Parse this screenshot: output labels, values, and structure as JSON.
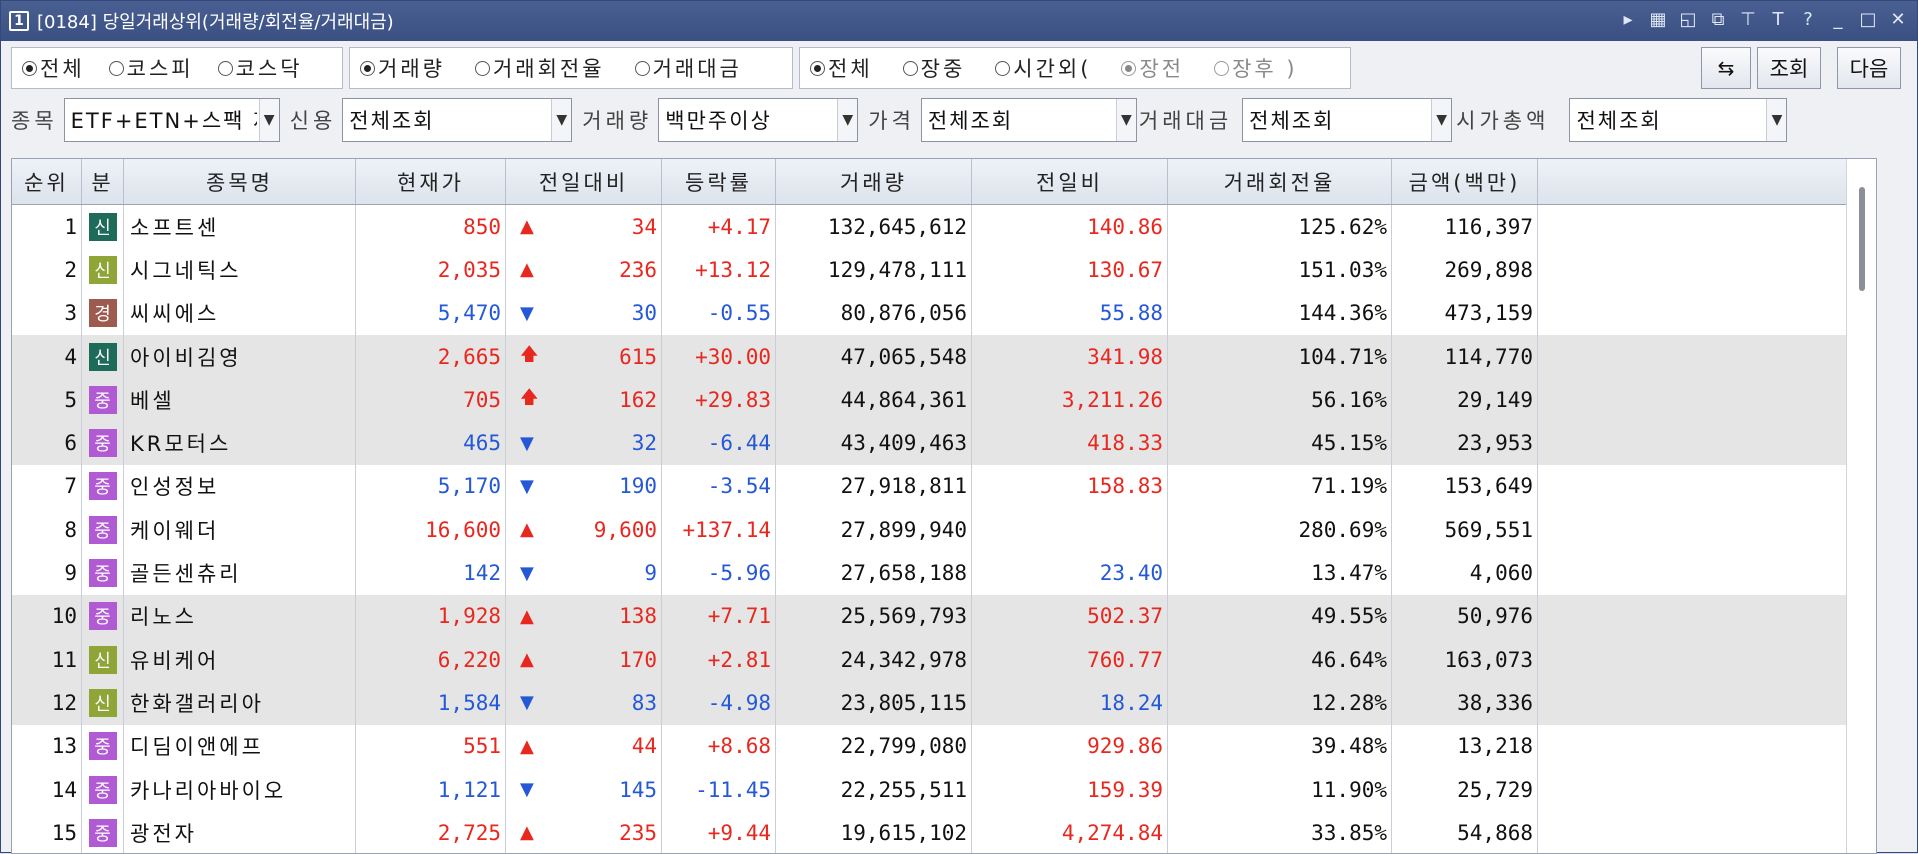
{
  "window": {
    "number": "1",
    "title": "[0184] 당일거래상위(거래량/회전율/거래대금)"
  },
  "title_icons": [
    "play-icon",
    "grid-icon",
    "window-icon",
    "restore-icon",
    "pin-icon",
    "font-icon",
    "help-icon",
    "minimize-icon",
    "maximize-icon",
    "close-icon"
  ],
  "market_radios": [
    {
      "label": "전체",
      "checked": true
    },
    {
      "label": "코스피",
      "checked": false
    },
    {
      "label": "코스닥",
      "checked": false
    }
  ],
  "sort_radios": [
    {
      "label": "거래량",
      "checked": true
    },
    {
      "label": "거래회전율",
      "checked": false
    },
    {
      "label": "거래대금",
      "checked": false
    }
  ],
  "session_radios": [
    {
      "label": "전체",
      "checked": true
    },
    {
      "label": "장중",
      "checked": false
    },
    {
      "label": "시간외(",
      "checked": false
    },
    {
      "label": "장전",
      "checked": true,
      "dim": true
    },
    {
      "label": "장후 )",
      "checked": false,
      "dim": true
    }
  ],
  "buttons": {
    "swap_icon": "swap-icon",
    "query": "조회",
    "next": "다음"
  },
  "filters": {
    "stock_label": "종목",
    "stock_value": "ETF+ETN+스팩 제",
    "credit_label": "신용",
    "credit_value": "전체조회",
    "volume_label": "거래량",
    "volume_value": "백만주이상",
    "price_label": "가격",
    "price_value": "전체조회",
    "amount_label": "거래대금",
    "amount_value": "전체조회",
    "mcap_label": "시가총액",
    "mcap_value": "전체조회"
  },
  "columns": [
    "순위",
    "분",
    "종목명",
    "현재가",
    "전일대비",
    "등락률",
    "거래량",
    "전일비",
    "거래회전율",
    "금액(백만)"
  ],
  "colors": {
    "신_green": "#1f6b5a",
    "신_olive": "#8fa537",
    "경": "#9d5a4f",
    "중": "#b05bd3",
    "up": "#e8271e",
    "down": "#2458d6"
  },
  "rows": [
    {
      "rank": "1",
      "badge": "신",
      "badge_color": "#1f6b5a",
      "name": "소프트센",
      "price": "850",
      "dir": "up",
      "arrow": "▲",
      "change": "34",
      "rate": "+4.17",
      "volume": "132,645,612",
      "prev_ratio": "140.86",
      "pr_color": "red",
      "turnover": "125.62%",
      "amount": "116,397",
      "shade": false
    },
    {
      "rank": "2",
      "badge": "신",
      "badge_color": "#8fa537",
      "name": "시그네틱스",
      "price": "2,035",
      "dir": "up",
      "arrow": "▲",
      "change": "236",
      "rate": "+13.12",
      "volume": "129,478,111",
      "prev_ratio": "130.67",
      "pr_color": "red",
      "turnover": "151.03%",
      "amount": "269,898",
      "shade": false
    },
    {
      "rank": "3",
      "badge": "경",
      "badge_color": "#9d5a4f",
      "name": "씨씨에스",
      "price": "5,470",
      "dir": "down",
      "arrow": "▼",
      "change": "30",
      "rate": "-0.55",
      "volume": "80,876,056",
      "prev_ratio": "55.88",
      "pr_color": "blue",
      "turnover": "144.36%",
      "amount": "473,159",
      "shade": false
    },
    {
      "rank": "4",
      "badge": "신",
      "badge_color": "#1f6b5a",
      "name": "아이비김영",
      "price": "2,665",
      "dir": "up",
      "arrow": "🡅",
      "change": "615",
      "rate": "+30.00",
      "volume": "47,065,548",
      "prev_ratio": "341.98",
      "pr_color": "red",
      "turnover": "104.71%",
      "amount": "114,770",
      "shade": true
    },
    {
      "rank": "5",
      "badge": "중",
      "badge_color": "#b05bd3",
      "name": "베셀",
      "price": "705",
      "dir": "up",
      "arrow": "🡅",
      "change": "162",
      "rate": "+29.83",
      "volume": "44,864,361",
      "prev_ratio": "3,211.26",
      "pr_color": "red",
      "turnover": "56.16%",
      "amount": "29,149",
      "shade": true
    },
    {
      "rank": "6",
      "badge": "중",
      "badge_color": "#b05bd3",
      "name": "KR모터스",
      "price": "465",
      "dir": "down",
      "arrow": "▼",
      "change": "32",
      "rate": "-6.44",
      "volume": "43,409,463",
      "prev_ratio": "418.33",
      "pr_color": "red",
      "turnover": "45.15%",
      "amount": "23,953",
      "shade": true
    },
    {
      "rank": "7",
      "badge": "중",
      "badge_color": "#b05bd3",
      "name": "인성정보",
      "price": "5,170",
      "dir": "down",
      "arrow": "▼",
      "change": "190",
      "rate": "-3.54",
      "volume": "27,918,811",
      "prev_ratio": "158.83",
      "pr_color": "red",
      "turnover": "71.19%",
      "amount": "153,649",
      "shade": false
    },
    {
      "rank": "8",
      "badge": "중",
      "badge_color": "#b05bd3",
      "name": "케이웨더",
      "price": "16,600",
      "dir": "up",
      "arrow": "▲",
      "change": "9,600",
      "rate": "+137.14",
      "volume": "27,899,940",
      "prev_ratio": "",
      "pr_color": "red",
      "turnover": "280.69%",
      "amount": "569,551",
      "shade": false
    },
    {
      "rank": "9",
      "badge": "중",
      "badge_color": "#b05bd3",
      "name": "골든센츄리",
      "price": "142",
      "dir": "down",
      "arrow": "▼",
      "change": "9",
      "rate": "-5.96",
      "volume": "27,658,188",
      "prev_ratio": "23.40",
      "pr_color": "blue",
      "turnover": "13.47%",
      "amount": "4,060",
      "shade": false
    },
    {
      "rank": "10",
      "badge": "중",
      "badge_color": "#b05bd3",
      "name": "리노스",
      "price": "1,928",
      "dir": "up",
      "arrow": "▲",
      "change": "138",
      "rate": "+7.71",
      "volume": "25,569,793",
      "prev_ratio": "502.37",
      "pr_color": "red",
      "turnover": "49.55%",
      "amount": "50,976",
      "shade": true
    },
    {
      "rank": "11",
      "badge": "신",
      "badge_color": "#8fa537",
      "name": "유비케어",
      "price": "6,220",
      "dir": "up",
      "arrow": "▲",
      "change": "170",
      "rate": "+2.81",
      "volume": "24,342,978",
      "prev_ratio": "760.77",
      "pr_color": "red",
      "turnover": "46.64%",
      "amount": "163,073",
      "shade": true
    },
    {
      "rank": "12",
      "badge": "신",
      "badge_color": "#8fa537",
      "name": "한화갤러리아",
      "price": "1,584",
      "dir": "down",
      "arrow": "▼",
      "change": "83",
      "rate": "-4.98",
      "volume": "23,805,115",
      "prev_ratio": "18.24",
      "pr_color": "blue",
      "turnover": "12.28%",
      "amount": "38,336",
      "shade": true
    },
    {
      "rank": "13",
      "badge": "중",
      "badge_color": "#b05bd3",
      "name": "디딤이앤에프",
      "price": "551",
      "dir": "up",
      "arrow": "▲",
      "change": "44",
      "rate": "+8.68",
      "volume": "22,799,080",
      "prev_ratio": "929.86",
      "pr_color": "red",
      "turnover": "39.48%",
      "amount": "13,218",
      "shade": false
    },
    {
      "rank": "14",
      "badge": "중",
      "badge_color": "#b05bd3",
      "name": "카나리아바이오",
      "price": "1,121",
      "dir": "down",
      "arrow": "▼",
      "change": "145",
      "rate": "-11.45",
      "volume": "22,255,511",
      "prev_ratio": "159.39",
      "pr_color": "red",
      "turnover": "11.90%",
      "amount": "25,729",
      "shade": false
    },
    {
      "rank": "15",
      "badge": "중",
      "badge_color": "#b05bd3",
      "name": "광전자",
      "price": "2,725",
      "dir": "up",
      "arrow": "▲",
      "change": "235",
      "rate": "+9.44",
      "volume": "19,615,102",
      "prev_ratio": "4,274.84",
      "pr_color": "red",
      "turnover": "33.85%",
      "amount": "54,868",
      "shade": false
    }
  ]
}
